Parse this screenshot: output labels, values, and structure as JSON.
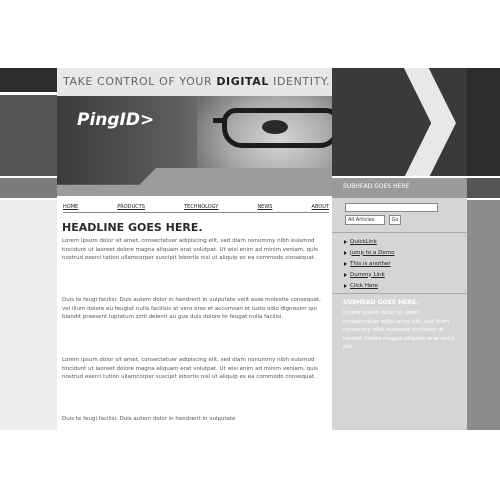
{
  "header": {
    "tagline_pre": "TAKE CONTROL OF YOUR ",
    "tagline_bold": "DIGITAL",
    "tagline_post": " IDENTITY.",
    "logo": "PingID>"
  },
  "nav": {
    "items": [
      "HOME",
      "PRODUCTS",
      "TECHNOLOGY",
      "NEWS",
      "ABOUT"
    ]
  },
  "main": {
    "headline": "HEADLINE GOES HERE.",
    "paragraphs": [
      "Lorem ipsum dolor sit amet, consectetuer adipiscing elit, sed diam nonummy nibh euismod tincidunt ut laoreet dolore magna aliquam erat volutpat. Ut wisi enim ad minim veniam, quis nostrud exerci tation ullamcorper suscipit lobortis nisl ut aliquip ex ea commodo consequat.",
      "Duis te feugi facilisi. Duis autem dolor in hendrerit in vulputate velit esse molestie consequat, vel illum dolore eu feugiat nulla facilisis at vero eros et accumsan et iusto odio dignissim qui blandit praesent luptatum zzril delenit au gue duis dolore te feugat nulla facilisi.",
      "Lorem ipsum dolor sit amet, consectetuer adipiscing elit, sed diam nonummy nibh euismod tincidunt ut laoreet dolore magna aliquam erat volutpat. Ut wisi enim ad minim veniam, quis nostrud exerci tution ullamcorper suscipit lobortis nisl ut aliquip ex ea commodo consequat.",
      "Duis te feugi facilisi. Duis autem dolor in hendrerit in vulputate"
    ]
  },
  "sidebar": {
    "head": "SUBHEAD GOES HERE",
    "search_select": "All Articles",
    "search_go": "Go",
    "links": [
      "QuickLink",
      "Jump to a Demo",
      "This is another",
      "Dummy Link",
      "Click Here"
    ],
    "subhead": "SUBHEAD GOES HERE.",
    "para": "Lorem ipsum dolor sit amet, consectetuer adipi scing elit, sed diam nonummy nibh euismod tincidunt ut laoreet dolore magna aliquam erat volut pat."
  },
  "icons": {
    "chevron": "chevron-right-icon",
    "bullet": "arrow-bullet-icon"
  }
}
